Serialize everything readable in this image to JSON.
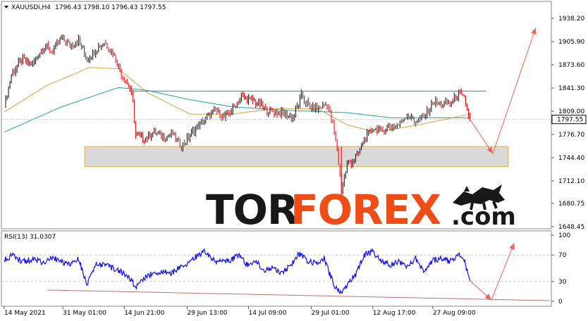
{
  "header": {
    "symbol": "XAUUSDi,H4",
    "ohlc": "1796.43 1798.10 1796.43 1797.55"
  },
  "watermark": {
    "part1": "TOR",
    "part2": "FOREX",
    "part3": ".com"
  },
  "colors": {
    "bull_candle": "#000000",
    "bear_candle": "#d50000",
    "ma_fast": "#e0a23a",
    "ma_slow": "#1fa3a3",
    "resistance": "#2a8fa8",
    "zone_fill": "#d9d9d9",
    "zone_border": "#e8b04a",
    "arrow": "#f0625a",
    "rsi_line": "#1010ee",
    "rsi_trend": "#c07070",
    "grid": "#c8c8c8",
    "brand_orange": "#f04a12"
  },
  "chart_data": [
    {
      "type": "line",
      "description_hidden": false,
      "title": "XAUUSDi,H4",
      "x_labels": [
        "14 May 2021",
        "31 May 01:00",
        "14 Jun 21:00",
        "29 Jun 13:00",
        "14 Jul 09:00",
        "29 Jul 01:00",
        "12 Aug 17:00",
        "27 Aug 09:00"
      ],
      "y_ticks": [
        "1938.20",
        "1905.90",
        "1873.60",
        "1841.30",
        "1809.00",
        "1776.70",
        "1744.40",
        "1712.10",
        "1680.75",
        "1648.45"
      ],
      "ylim": [
        1648.45,
        1950
      ],
      "current_price": "1797.55",
      "current_price_value": 1797.55,
      "price_series": [
        {
          "t": 0,
          "v": 1815
        },
        {
          "t": 5,
          "v": 1860
        },
        {
          "t": 12,
          "v": 1880
        },
        {
          "t": 20,
          "v": 1875
        },
        {
          "t": 28,
          "v": 1900
        },
        {
          "t": 34,
          "v": 1892
        },
        {
          "t": 40,
          "v": 1912
        },
        {
          "t": 46,
          "v": 1900
        },
        {
          "t": 52,
          "v": 1908
        },
        {
          "t": 58,
          "v": 1880
        },
        {
          "t": 64,
          "v": 1895
        },
        {
          "t": 70,
          "v": 1905
        },
        {
          "t": 76,
          "v": 1890
        },
        {
          "t": 82,
          "v": 1862
        },
        {
          "t": 88,
          "v": 1840
        },
        {
          "t": 90,
          "v": 1820
        },
        {
          "t": 92,
          "v": 1775
        },
        {
          "t": 98,
          "v": 1770
        },
        {
          "t": 105,
          "v": 1780
        },
        {
          "t": 112,
          "v": 1772
        },
        {
          "t": 118,
          "v": 1778
        },
        {
          "t": 124,
          "v": 1760
        },
        {
          "t": 130,
          "v": 1775
        },
        {
          "t": 136,
          "v": 1790
        },
        {
          "t": 142,
          "v": 1800
        },
        {
          "t": 148,
          "v": 1810
        },
        {
          "t": 154,
          "v": 1800
        },
        {
          "t": 160,
          "v": 1812
        },
        {
          "t": 166,
          "v": 1830
        },
        {
          "t": 172,
          "v": 1825
        },
        {
          "t": 178,
          "v": 1820
        },
        {
          "t": 184,
          "v": 1810
        },
        {
          "t": 190,
          "v": 1808
        },
        {
          "t": 196,
          "v": 1805
        },
        {
          "t": 202,
          "v": 1800
        },
        {
          "t": 208,
          "v": 1830
        },
        {
          "t": 214,
          "v": 1815
        },
        {
          "t": 220,
          "v": 1812
        },
        {
          "t": 226,
          "v": 1820
        },
        {
          "t": 230,
          "v": 1790
        },
        {
          "t": 233,
          "v": 1755
        },
        {
          "t": 236,
          "v": 1700
        },
        {
          "t": 240,
          "v": 1735
        },
        {
          "t": 244,
          "v": 1740
        },
        {
          "t": 248,
          "v": 1750
        },
        {
          "t": 252,
          "v": 1770
        },
        {
          "t": 258,
          "v": 1785
        },
        {
          "t": 264,
          "v": 1782
        },
        {
          "t": 270,
          "v": 1788
        },
        {
          "t": 276,
          "v": 1790
        },
        {
          "t": 282,
          "v": 1805
        },
        {
          "t": 288,
          "v": 1795
        },
        {
          "t": 294,
          "v": 1800
        },
        {
          "t": 300,
          "v": 1822
        },
        {
          "t": 306,
          "v": 1818
        },
        {
          "t": 312,
          "v": 1820
        },
        {
          "t": 318,
          "v": 1833
        },
        {
          "t": 322,
          "v": 1826
        },
        {
          "t": 326,
          "v": 1797.55
        }
      ],
      "ma_fast_series": [
        {
          "t": 0,
          "v": 1808
        },
        {
          "t": 30,
          "v": 1845
        },
        {
          "t": 60,
          "v": 1870
        },
        {
          "t": 80,
          "v": 1868
        },
        {
          "t": 100,
          "v": 1835
        },
        {
          "t": 130,
          "v": 1805
        },
        {
          "t": 160,
          "v": 1805
        },
        {
          "t": 190,
          "v": 1813
        },
        {
          "t": 220,
          "v": 1812
        },
        {
          "t": 240,
          "v": 1790
        },
        {
          "t": 260,
          "v": 1780
        },
        {
          "t": 290,
          "v": 1790
        },
        {
          "t": 326,
          "v": 1805
        }
      ],
      "ma_slow_series": [
        {
          "t": 0,
          "v": 1780
        },
        {
          "t": 40,
          "v": 1815
        },
        {
          "t": 80,
          "v": 1842
        },
        {
          "t": 100,
          "v": 1838
        },
        {
          "t": 130,
          "v": 1825
        },
        {
          "t": 160,
          "v": 1815
        },
        {
          "t": 200,
          "v": 1810
        },
        {
          "t": 240,
          "v": 1807
        },
        {
          "t": 270,
          "v": 1800
        },
        {
          "t": 300,
          "v": 1800
        },
        {
          "t": 326,
          "v": 1800
        }
      ],
      "resistance_level": 1837,
      "resistance_span": [
        118,
        442
      ],
      "support_zone": {
        "low": 1732,
        "high": 1760,
        "span": [
          75,
          460
        ]
      },
      "forecast_path": [
        {
          "t": 326,
          "v": 1797.55
        },
        {
          "t": 342,
          "v": 1750
        },
        {
          "t": 372,
          "v": 1925
        }
      ]
    },
    {
      "type": "line",
      "title": "RSI(13) 31.0307",
      "label": "RSI(13) 31.0307",
      "y_ticks": [
        "100",
        "70",
        "30",
        "0"
      ],
      "ylim": [
        0,
        100
      ],
      "levels": [
        70,
        30
      ],
      "rsi_series": [
        {
          "t": 0,
          "v": 62
        },
        {
          "t": 6,
          "v": 70
        },
        {
          "t": 12,
          "v": 60
        },
        {
          "t": 20,
          "v": 63
        },
        {
          "t": 28,
          "v": 58
        },
        {
          "t": 34,
          "v": 66
        },
        {
          "t": 40,
          "v": 60
        },
        {
          "t": 46,
          "v": 55
        },
        {
          "t": 52,
          "v": 64
        },
        {
          "t": 58,
          "v": 25
        },
        {
          "t": 64,
          "v": 55
        },
        {
          "t": 70,
          "v": 56
        },
        {
          "t": 76,
          "v": 50
        },
        {
          "t": 82,
          "v": 45
        },
        {
          "t": 88,
          "v": 35
        },
        {
          "t": 92,
          "v": 20
        },
        {
          "t": 98,
          "v": 35
        },
        {
          "t": 104,
          "v": 42
        },
        {
          "t": 110,
          "v": 46
        },
        {
          "t": 116,
          "v": 42
        },
        {
          "t": 122,
          "v": 50
        },
        {
          "t": 128,
          "v": 58
        },
        {
          "t": 134,
          "v": 67
        },
        {
          "t": 140,
          "v": 75
        },
        {
          "t": 146,
          "v": 62
        },
        {
          "t": 152,
          "v": 60
        },
        {
          "t": 158,
          "v": 62
        },
        {
          "t": 164,
          "v": 70
        },
        {
          "t": 170,
          "v": 55
        },
        {
          "t": 176,
          "v": 62
        },
        {
          "t": 182,
          "v": 45
        },
        {
          "t": 188,
          "v": 50
        },
        {
          "t": 194,
          "v": 44
        },
        {
          "t": 200,
          "v": 52
        },
        {
          "t": 206,
          "v": 72
        },
        {
          "t": 212,
          "v": 62
        },
        {
          "t": 218,
          "v": 58
        },
        {
          "t": 224,
          "v": 65
        },
        {
          "t": 228,
          "v": 40
        },
        {
          "t": 232,
          "v": 20
        },
        {
          "t": 236,
          "v": 15
        },
        {
          "t": 240,
          "v": 25
        },
        {
          "t": 246,
          "v": 40
        },
        {
          "t": 252,
          "v": 70
        },
        {
          "t": 258,
          "v": 75
        },
        {
          "t": 264,
          "v": 62
        },
        {
          "t": 270,
          "v": 55
        },
        {
          "t": 276,
          "v": 60
        },
        {
          "t": 282,
          "v": 52
        },
        {
          "t": 288,
          "v": 65
        },
        {
          "t": 294,
          "v": 45
        },
        {
          "t": 300,
          "v": 62
        },
        {
          "t": 306,
          "v": 65
        },
        {
          "t": 312,
          "v": 60
        },
        {
          "t": 318,
          "v": 72
        },
        {
          "t": 322,
          "v": 62
        },
        {
          "t": 326,
          "v": 31.03
        }
      ],
      "trendline": [
        {
          "t": 30,
          "v": 17
        },
        {
          "t": 382,
          "v": 1
        }
      ],
      "forecast_path": [
        {
          "t": 326,
          "v": 31.03
        },
        {
          "t": 341,
          "v": 2
        },
        {
          "t": 357,
          "v": 88
        }
      ]
    }
  ]
}
